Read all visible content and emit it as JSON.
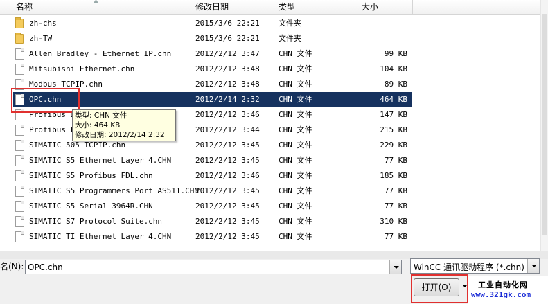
{
  "columns": {
    "name": "名称",
    "date": "修改日期",
    "type": "类型",
    "size": "大小"
  },
  "files": [
    {
      "name": "zh-chs",
      "date": "2015/3/6 22:21",
      "type": "文件夹",
      "size": "",
      "icon": "folder-icon"
    },
    {
      "name": "zh-TW",
      "date": "2015/3/6 22:21",
      "type": "文件夹",
      "size": "",
      "icon": "folder-icon"
    },
    {
      "name": "Allen Bradley - Ethernet IP.chn",
      "date": "2012/2/12 3:47",
      "type": "CHN 文件",
      "size": "99 KB",
      "icon": "file-icon"
    },
    {
      "name": "Mitsubishi Ethernet.chn",
      "date": "2012/2/12 3:48",
      "type": "CHN 文件",
      "size": "104 KB",
      "icon": "file-icon"
    },
    {
      "name": "Modbus TCPIP.chn",
      "date": "2012/2/12 3:48",
      "type": "CHN 文件",
      "size": "89 KB",
      "icon": "file-icon"
    },
    {
      "name": "OPC.chn",
      "date": "2012/2/14 2:32",
      "type": "CHN 文件",
      "size": "464 KB",
      "icon": "file-icon",
      "selected": true
    },
    {
      "name": "Profibus DP.chn",
      "date": "2012/2/12 3:46",
      "type": "CHN 文件",
      "size": "147 KB",
      "icon": "file-icon"
    },
    {
      "name": "Profibus FMS.chn",
      "date": "2012/2/12 3:44",
      "type": "CHN 文件",
      "size": "215 KB",
      "icon": "file-icon"
    },
    {
      "name": "SIMATIC 505 TCPIP.chn",
      "date": "2012/2/12 3:45",
      "type": "CHN 文件",
      "size": "229 KB",
      "icon": "file-icon"
    },
    {
      "name": "SIMATIC S5 Ethernet Layer 4.CHN",
      "date": "2012/2/12 3:45",
      "type": "CHN 文件",
      "size": "77 KB",
      "icon": "file-icon"
    },
    {
      "name": "SIMATIC S5 Profibus FDL.chn",
      "date": "2012/2/12 3:46",
      "type": "CHN 文件",
      "size": "185 KB",
      "icon": "file-icon"
    },
    {
      "name": "SIMATIC S5 Programmers Port AS511.CHN",
      "date": "2012/2/12 3:45",
      "type": "CHN 文件",
      "size": "77 KB",
      "icon": "file-icon"
    },
    {
      "name": "SIMATIC S5 Serial 3964R.CHN",
      "date": "2012/2/12 3:45",
      "type": "CHN 文件",
      "size": "77 KB",
      "icon": "file-icon"
    },
    {
      "name": "SIMATIC S7 Protocol Suite.chn",
      "date": "2012/2/12 3:45",
      "type": "CHN 文件",
      "size": "310 KB",
      "icon": "file-icon"
    },
    {
      "name": "SIMATIC TI Ethernet Layer 4.CHN",
      "date": "2012/2/12 3:45",
      "type": "CHN 文件",
      "size": "77 KB",
      "icon": "file-icon"
    }
  ],
  "tooltip": {
    "type_line": "类型: CHN 文件",
    "size_line": "大小: 464 KB",
    "date_line": "修改日期: 2012/2/14 2:32"
  },
  "filename": {
    "label": "名(N):",
    "value": "OPC.chn"
  },
  "filetype": {
    "selected": "WinCC 通讯驱动程序 (*.chn)"
  },
  "open_button": {
    "label": "打开(O)"
  },
  "watermark": {
    "line1": "工业自动化网",
    "line2": "www.321gk.com"
  },
  "colors": {
    "selection": "#16325f",
    "highlight_box": "#e0302f",
    "tooltip_bg": "#ffffe1",
    "watermark_link": "#1a2bd6"
  }
}
